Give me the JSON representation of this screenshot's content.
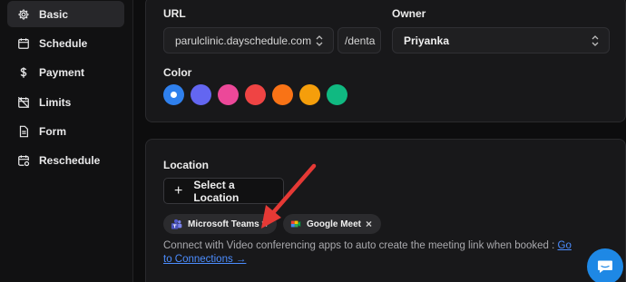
{
  "sidebar": {
    "items": [
      {
        "label": "Basic",
        "icon": "gear-icon",
        "active": true
      },
      {
        "label": "Schedule",
        "icon": "calendar-icon"
      },
      {
        "label": "Payment",
        "icon": "dollar-icon"
      },
      {
        "label": "Limits",
        "icon": "calendar-off-icon"
      },
      {
        "label": "Form",
        "icon": "document-icon"
      },
      {
        "label": "Reschedule",
        "icon": "calendar-refresh-icon"
      }
    ]
  },
  "basic": {
    "url_label": "URL",
    "url_domain": "parulclinic.dayschedule.com",
    "url_path": "/denta",
    "owner_label": "Owner",
    "owner_value": "Priyanka",
    "color_label": "Color",
    "colors": [
      "#2f80ed",
      "#6366f1",
      "#ec4899",
      "#ef4444",
      "#f97316",
      "#f59e0b",
      "#10b981"
    ],
    "selected_color_index": 0
  },
  "location": {
    "label": "Location",
    "add_button": "Select a Location",
    "chips": [
      {
        "label": "Microsoft Teams",
        "icon": "microsoft-teams-icon"
      },
      {
        "label": "Google Meet",
        "icon": "google-meet-icon"
      }
    ],
    "helper_text": "Connect with Video conferencing apps to auto create the meeting link when booked : ",
    "helper_link": "Go to Connections →"
  },
  "annotation": {
    "arrow_color": "#e53935"
  },
  "chat": {
    "icon": "chat-icon",
    "color": "#1e88e5"
  }
}
